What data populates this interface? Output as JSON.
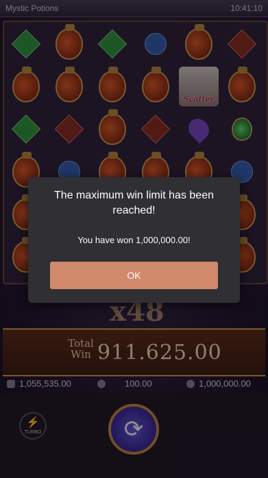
{
  "header": {
    "game_title": "Mystic Potions",
    "clock": "10:41:10"
  },
  "reels": {
    "scatter_label": "Scatter",
    "symbols": [
      [
        "gem-green",
        "potion",
        "gem-green",
        "gem-blue",
        "potion",
        "gem-red"
      ],
      [
        "potion",
        "potion",
        "potion",
        "potion",
        "scatter",
        "potion"
      ],
      [
        "gem-green",
        "gem-red",
        "potion",
        "gem-red",
        "gem-heart",
        "flask"
      ],
      [
        "potion",
        "gem-blue",
        "potion",
        "potion",
        "potion",
        "gem-blue"
      ],
      [
        "potion",
        "",
        "",
        "",
        "",
        "potion"
      ],
      [
        "potion",
        "",
        "",
        "",
        "",
        "potion"
      ]
    ]
  },
  "feature": {
    "multiplier": "x48"
  },
  "total_win": {
    "label": "Total Win",
    "value": "911.625.00"
  },
  "stats": {
    "balance": "1,055,535.00",
    "bet": "100.00",
    "win": "1,000,000.00"
  },
  "controls": {
    "turbo_label": "TURBO"
  },
  "dialog": {
    "message": "The maximum win limit has been reached!",
    "won_text": "You have won 1,000,000.00!",
    "ok_label": "OK"
  },
  "colors": {
    "accent": "#d0896a",
    "dialog_bg": "#2f2f34",
    "spin": "#3b2aa0"
  }
}
